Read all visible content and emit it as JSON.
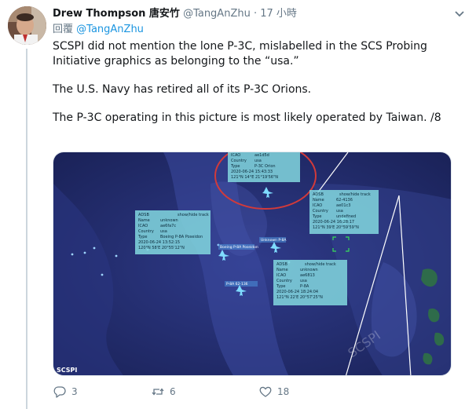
{
  "tweet": {
    "author_name": "Drew Thompson 唐安竹",
    "handle": "@TangAnZhu",
    "separator": "·",
    "time": "17 小時",
    "reply_prefix": "回覆",
    "reply_to": "@TangAnZhu",
    "paragraphs": [
      "SCSPI did not mention the lone P-3C, mislabelled in the SCS Probing Initiative graphics as belonging to the “usa.”",
      "The U.S. Navy has retired all of its P-3C Orions.",
      "The P-3C operating in this picture is most likely operated by Taiwan. /8"
    ]
  },
  "media": {
    "watermark_bottom_left": "SCSPI",
    "watermark_center": "SCSPI",
    "boxes": [
      {
        "lines": [
          "ICAO",
          "Country",
          "Type",
          "2020-06-24 15:43:33",
          "121°N 14°E  21°19'56\"N"
        ],
        "values": [
          "ae1d5d",
          "usa",
          "P-3C Orion",
          "",
          ""
        ]
      },
      {
        "header": "ADSB",
        "header_right": "show/hide track",
        "lines": [
          "Name",
          "ICAO",
          "Country",
          "Type",
          "2020-06-24 13:52:15",
          "120°N 58'E  20°55'12\"N"
        ],
        "values": [
          "unknown",
          "ae6fa7c",
          "usa",
          "Boeing P-8A Poseidon",
          "",
          ""
        ]
      },
      {
        "header": "ADSB",
        "header_right": "show/hide track",
        "lines": [
          "Name",
          "ICAO",
          "Country",
          "Type",
          "2020-06-24 16:28:17",
          "121°N 39'E  20°59'59\"N"
        ],
        "values": [
          "62-4136",
          "ae01c3",
          "usa",
          "undefined",
          "",
          ""
        ]
      },
      {
        "header": "ADSB",
        "header_right": "show/hide track",
        "lines": [
          "Name",
          "ICAO",
          "Country",
          "Type",
          "2020-06-24 18:24:04",
          "121°N 22'E  20°57'25\"N"
        ],
        "values": [
          "unknown",
          "ae6813",
          "usa",
          "P-8A",
          "",
          ""
        ]
      }
    ],
    "track_labels": [
      "Boeing P-8A Poseidon",
      "Unknown P-8A",
      "P-8A 62-136"
    ]
  },
  "actions": {
    "reply_count": "",
    "reply_value": "3",
    "retweet_value": "6",
    "like_value": "18"
  }
}
